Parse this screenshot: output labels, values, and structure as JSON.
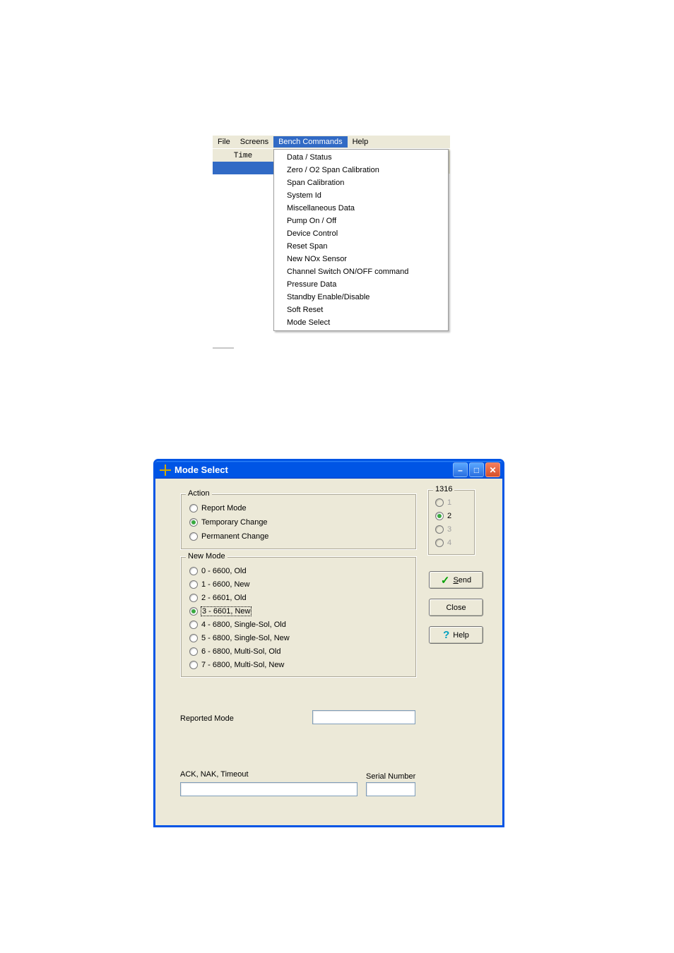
{
  "menubar": {
    "file": "File",
    "screens": "Screens",
    "bench": "Bench Commands",
    "help": "Help"
  },
  "header_col": "Time",
  "bench_menu": [
    "Data / Status",
    "Zero / O2 Span Calibration",
    "Span Calibration",
    "System Id",
    "Miscellaneous Data",
    "Pump On / Off",
    "Device Control",
    "Reset Span",
    "New NOx Sensor",
    "Channel Switch ON/OFF command",
    "Pressure Data",
    "Standby Enable/Disable",
    "Soft Reset",
    "Mode Select"
  ],
  "win2": {
    "title": "Mode Select",
    "action": {
      "legend": "Action",
      "report": "Report Mode",
      "temporary": "Temporary Change",
      "permanent": "Permanent Change",
      "selected": 1
    },
    "newmode": {
      "legend": "New Mode",
      "options": [
        "0 - 6600, Old",
        "1 - 6600, New",
        "2 - 6601, Old",
        "3 - 6601, New",
        "4 - 6800, Single-Sol, Old",
        "5 - 6800, Single-Sol, New",
        "6 - 6800, Multi-Sol, Old",
        "7 - 6800, Multi-Sol, New"
      ],
      "selected": 3
    },
    "group1316": {
      "legend": "1316",
      "options": [
        "1",
        "2",
        "3",
        "4"
      ],
      "selected": 1,
      "enabled": [
        false,
        true,
        false,
        false
      ]
    },
    "reported_mode_label": "Reported Mode",
    "reported_mode_value": "",
    "ack_label": "ACK, NAK, Timeout",
    "ack_value": "",
    "serial_label": "Serial Number",
    "serial_value": "",
    "buttons": {
      "send_u": "S",
      "send_rest": "end",
      "close": "Close",
      "help": "Help"
    }
  }
}
